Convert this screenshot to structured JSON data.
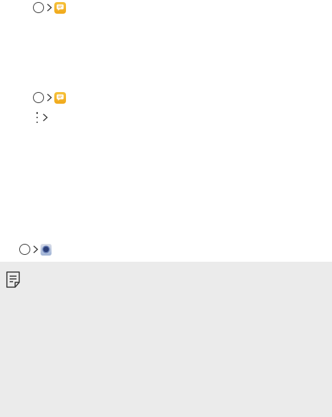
{
  "icons": {
    "home_button": "home-circle-icon",
    "separator": "chevron-right-icon",
    "messaging_app": "messaging-app-icon",
    "more_options": "more-vertical-icon",
    "camera_app": "camera-app-icon",
    "note": "note-icon"
  },
  "colors": {
    "messaging_app": "#f4b52a",
    "camera_app_lens": "#2c3f78",
    "note_panel": "#ebebeb",
    "glyph": "#333333"
  }
}
